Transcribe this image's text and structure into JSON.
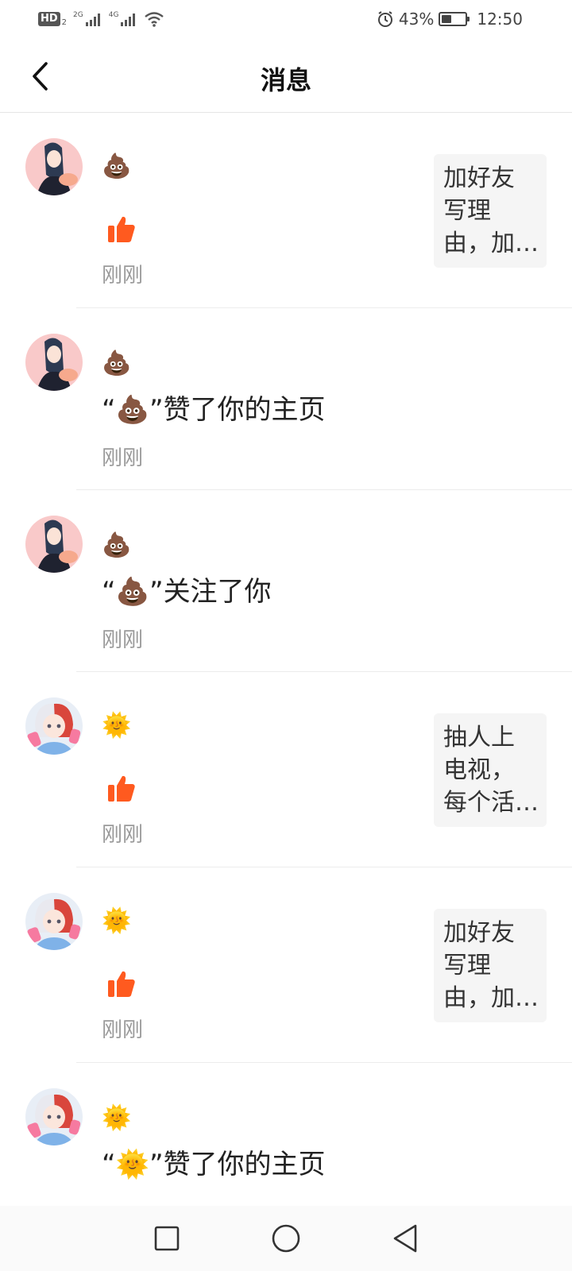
{
  "status_bar": {
    "hd": "HD",
    "hd_sub": "2",
    "net1": "2G",
    "net2": "4G",
    "battery_percent": "43%",
    "battery_level": 0.43,
    "time": "12:50"
  },
  "header": {
    "title": "消息"
  },
  "notifications": [
    {
      "avatar": "avatar-girl-pink",
      "name": "💩",
      "type": "like",
      "time": "刚刚",
      "preview": [
        "加好友",
        "写理",
        "由，加…"
      ]
    },
    {
      "avatar": "avatar-girl-pink",
      "name": "💩",
      "type": "text",
      "content": "“💩”赞了你的主页",
      "time": "刚刚"
    },
    {
      "avatar": "avatar-girl-pink",
      "name": "💩",
      "type": "text",
      "content": "“💩”关注了你",
      "time": "刚刚"
    },
    {
      "avatar": "avatar-boy-redwhite",
      "name": "🌞",
      "type": "like",
      "time": "刚刚",
      "preview": [
        "抽人上",
        "电视，",
        "每个活…"
      ]
    },
    {
      "avatar": "avatar-boy-redwhite",
      "name": "🌞",
      "type": "like",
      "time": "刚刚",
      "preview": [
        "加好友",
        "写理",
        "由，加…"
      ]
    },
    {
      "avatar": "avatar-boy-redwhite",
      "name": "🌞",
      "type": "text",
      "content": "“🌞”赞了你的主页",
      "time": ""
    }
  ],
  "colors": {
    "like": "#ff5a1f",
    "time": "#9a9a9a",
    "preview_bg": "#f5f5f5"
  },
  "nav": {
    "recent_icon": "square-icon",
    "home_icon": "circle-icon",
    "back_icon": "triangle-back-icon"
  }
}
